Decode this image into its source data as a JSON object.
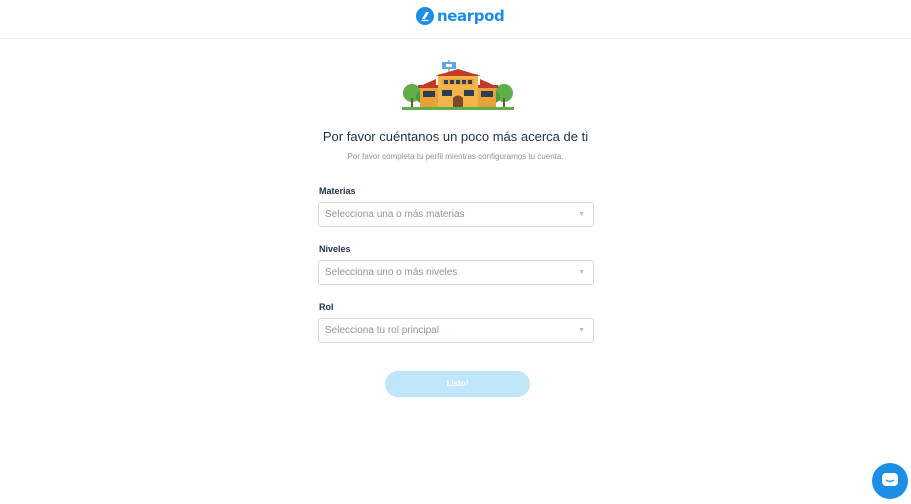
{
  "header": {
    "logo_text": "nearpod",
    "brand_color": "#1c8ee6"
  },
  "illustration": {
    "name": "school-building-icon"
  },
  "main": {
    "title": "Por favor cuéntanos un poco más acerca de ti",
    "subtitle": "Por favor completa tu perfil mientras configuramos tu cuenta."
  },
  "form": {
    "subjects": {
      "label": "Materias",
      "placeholder": "Selecciona una o más materias"
    },
    "levels": {
      "label": "Niveles",
      "placeholder": "Selecciona uno o más niveles"
    },
    "role": {
      "label": "Rol",
      "placeholder": "Selecciona tu rol principal"
    },
    "submit_label": "Listo!",
    "submit_color": "#bfe6fb"
  },
  "chat": {
    "icon": "chat-bubble-icon"
  }
}
